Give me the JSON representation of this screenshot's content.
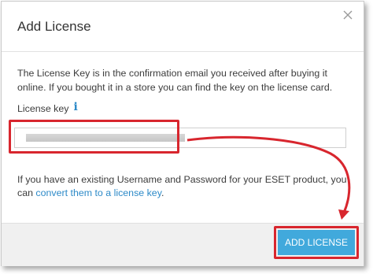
{
  "dialog": {
    "title": "Add License",
    "close_icon": "close-icon",
    "description": "The License Key is in the confirmation email you received after buying it online. If you bought it in a store you can find the key on the license card.",
    "license_key_label": "License key",
    "info_icon": "info-icon",
    "note_prefix": "If you have an existing Username and Password for your ESET product, you can ",
    "note_link": "convert them to a license key",
    "note_suffix": ".",
    "add_button": "ADD LICENSE"
  },
  "colors": {
    "accent": "#41a9dc",
    "link": "#2d8ac8",
    "highlight": "#d8262e"
  }
}
